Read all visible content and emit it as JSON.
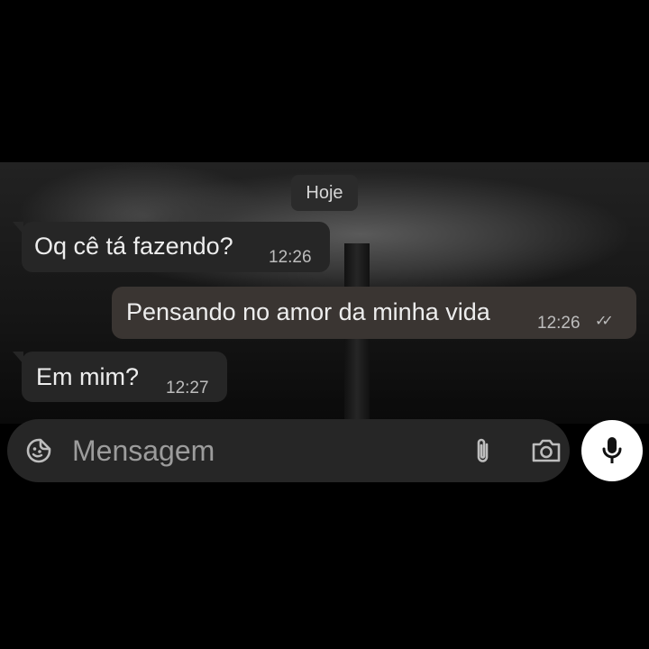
{
  "chat": {
    "date_chip": "Hoje",
    "messages": [
      {
        "direction": "in",
        "text": "Oq cê tá fazendo?",
        "time": "12:26"
      },
      {
        "direction": "out",
        "text": "Pensando no amor da minha vida",
        "time": "12:26",
        "status": "read"
      },
      {
        "direction": "in",
        "text": "Em mim?",
        "time": "12:27"
      }
    ]
  },
  "composer": {
    "placeholder": "Mensagem",
    "icons": [
      "emoji-sticker-icon",
      "paperclip-icon",
      "camera-icon"
    ],
    "send_button_icon": "microphone-icon"
  },
  "colors": {
    "background": "#000000",
    "incoming_bubble": "#262626",
    "outgoing_bubble": "#3a3532",
    "mic_button": "#ffffff"
  }
}
